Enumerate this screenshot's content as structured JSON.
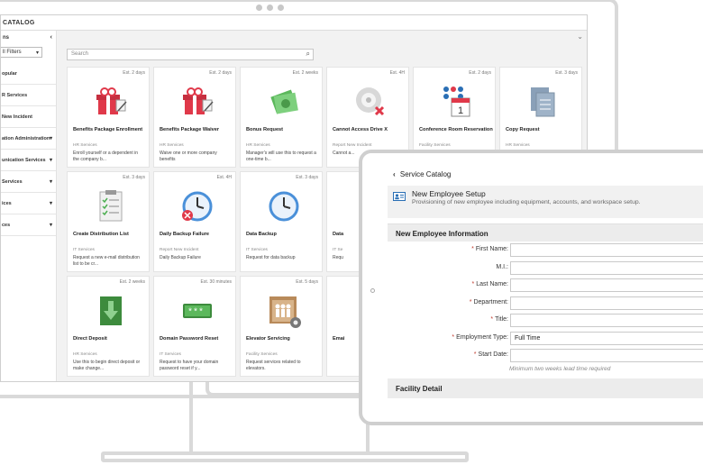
{
  "app": {
    "title": "CATALOG"
  },
  "sidebar": {
    "header": "ns",
    "collapse_icon": "chevron-left-icon",
    "filter": "ll Filters",
    "items": [
      {
        "label": "opular",
        "has_caret": false
      },
      {
        "label": "R Services",
        "has_caret": false
      },
      {
        "label": "New Incident",
        "has_caret": false
      },
      {
        "label": "ation Administration",
        "has_caret": true
      },
      {
        "label": "unication Services",
        "has_caret": true
      },
      {
        "label": "Services",
        "has_caret": true
      },
      {
        "label": "ices",
        "has_caret": true
      },
      {
        "label": "ces",
        "has_caret": true
      }
    ]
  },
  "main": {
    "search_placeholder": "Search",
    "cards": [
      {
        "est": "Est. 2 days",
        "title": "Benefits Package Enrollment",
        "category": "HR Services",
        "desc": "Enroll yourself or a dependent in the company b...",
        "icon": "gift-pen-icon"
      },
      {
        "est": "Est. 2 days",
        "title": "Benefits Package Waiver",
        "category": "HR Services",
        "desc": "Waive one or more company benefits",
        "icon": "gift-pen-icon"
      },
      {
        "est": "Est. 2 weeks",
        "title": "Bonus Request",
        "category": "HR Services",
        "desc": "Manager's will use this to request a one-time b...",
        "icon": "money-icon"
      },
      {
        "est": "Est. 4H",
        "title": "Cannot Access Drive X",
        "category": "Report New Incident",
        "desc": "Cannot a...",
        "icon": "disc-error-icon"
      },
      {
        "est": "Est. 2 days",
        "title": "Conference Room Reservation",
        "category": "Facility Services",
        "desc": "",
        "icon": "calendar-people-icon"
      },
      {
        "est": "Est. 3 days",
        "title": "Copy Request",
        "category": "HR Services",
        "desc": "",
        "icon": "copy-document-icon"
      },
      {
        "est": "Est. 3 days",
        "title": "Create Distribution List",
        "category": "IT Services",
        "desc": "Request a new e-mail distribution list to be cr...",
        "icon": "checklist-icon"
      },
      {
        "est": "Est. 4H",
        "title": "Daily Backup Failure",
        "category": "Report New Incident",
        "desc": "Daily Backup Failure",
        "icon": "backup-error-icon"
      },
      {
        "est": "Est. 3 days",
        "title": "Data Backup",
        "category": "IT Services",
        "desc": "Request for data backup",
        "icon": "backup-clock-icon"
      },
      {
        "est": "",
        "title": "Data",
        "category": "IT Se",
        "desc": "Requ",
        "icon": ""
      },
      {
        "est": "",
        "title": "",
        "category": "",
        "desc": "",
        "icon": ""
      },
      {
        "est": "",
        "title": "",
        "category": "",
        "desc": "",
        "icon": ""
      },
      {
        "est": "Est. 2 weeks",
        "title": "Direct Deposit",
        "category": "HR Services",
        "desc": "Use this to begin direct deposit or make change...",
        "icon": "download-deposit-icon"
      },
      {
        "est": "Est. 30 minutes",
        "title": "Domain Password Reset",
        "category": "IT Services",
        "desc": "Request to have your domain password reset if y...",
        "icon": "password-icon"
      },
      {
        "est": "Est. 5 days",
        "title": "Elevator Servicing",
        "category": "Facility Services",
        "desc": "Request services related to elevators.",
        "icon": "elevator-gear-icon"
      },
      {
        "est": "",
        "title": "Emai",
        "category": "",
        "desc": "",
        "icon": ""
      },
      {
        "est": "",
        "title": "",
        "category": "",
        "desc": "",
        "icon": ""
      },
      {
        "est": "",
        "title": "",
        "category": "",
        "desc": "",
        "icon": ""
      }
    ]
  },
  "tablet": {
    "nav_back": "Service Catalog",
    "header_title": "New Employee Setup",
    "header_desc": "Provisioning of new employee including equipment, accounts, and workspace setup.",
    "section1": "New Employee Information",
    "fields": [
      {
        "label": "First Name:",
        "required": true,
        "value": "",
        "type": "text"
      },
      {
        "label": "M.I.:",
        "required": false,
        "value": "",
        "type": "text"
      },
      {
        "label": "Last Name:",
        "required": true,
        "value": "",
        "type": "text"
      },
      {
        "label": "Department:",
        "required": true,
        "value": "",
        "type": "select"
      },
      {
        "label": "Title:",
        "required": true,
        "value": "",
        "type": "text"
      },
      {
        "label": "Employment Type:",
        "required": true,
        "value": "Full Time",
        "type": "select"
      },
      {
        "label": "Start Date:",
        "required": true,
        "value": "",
        "type": "date"
      }
    ],
    "hint": "Minimum two weeks lead time required",
    "section2": "Facility Detail"
  },
  "colors": {
    "accent_red": "#e0394a",
    "accent_blue": "#4a90d9",
    "green": "#4caf50"
  }
}
